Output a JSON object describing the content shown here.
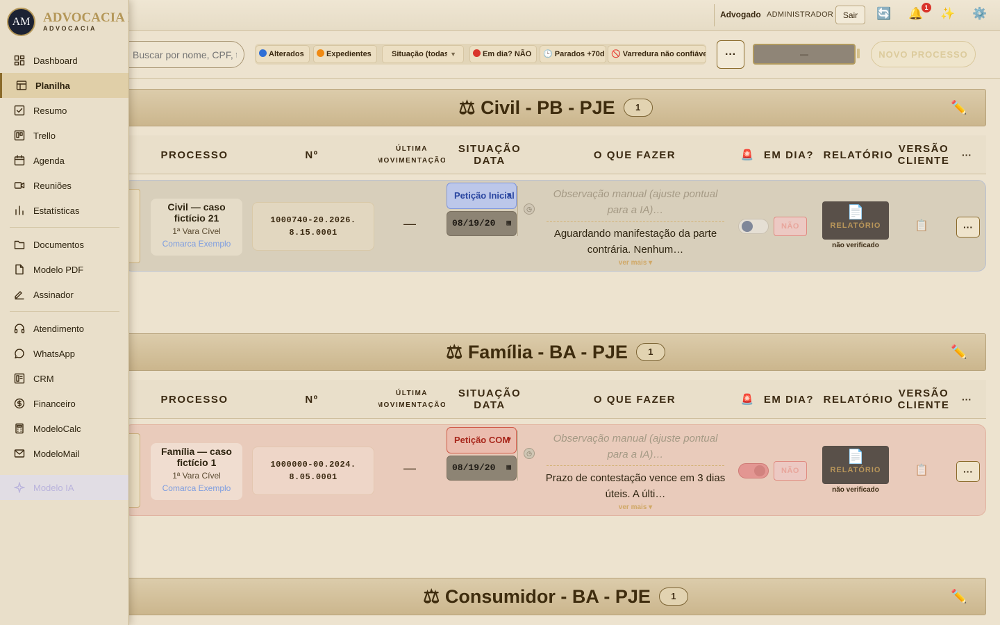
{
  "sidebar": {
    "brand": "ADVOCACIA I",
    "brand_sub": "ADVOCACIA",
    "logo_initials": "AM",
    "items": [
      {
        "label": "Dashboard",
        "icon": "dashboard-icon"
      },
      {
        "label": "Planilha",
        "icon": "table-icon",
        "active": true
      },
      {
        "label": "Resumo",
        "icon": "check-square-icon"
      },
      {
        "label": "Trello",
        "icon": "kanban-icon"
      },
      {
        "label": "Agenda",
        "icon": "calendar-icon"
      },
      {
        "label": "Reuniões",
        "icon": "video-icon"
      },
      {
        "label": "Estatísticas",
        "icon": "bar-chart-icon"
      },
      {
        "label": "Documentos",
        "icon": "folder-icon"
      },
      {
        "label": "Modelo PDF",
        "icon": "file-icon"
      },
      {
        "label": "Assinador",
        "icon": "signature-icon"
      },
      {
        "label": "Atendimento",
        "icon": "headset-icon"
      },
      {
        "label": "WhatsApp",
        "icon": "chat-icon"
      },
      {
        "label": "CRM",
        "icon": "crm-icon"
      },
      {
        "label": "Financeiro",
        "icon": "dollar-icon"
      },
      {
        "label": "ModeloCalc",
        "icon": "calculator-icon"
      },
      {
        "label": "ModeloMail",
        "icon": "mail-icon"
      },
      {
        "label": "Modelo IA",
        "icon": "sparkle-icon",
        "faded": true
      }
    ]
  },
  "topbar": {
    "role": "Advogado",
    "user": "ADMINISTRADOR",
    "logout_label": "Sair",
    "notification_count": "1",
    "icons": [
      "refresh-icon",
      "bell-icon",
      "sparkles-icon",
      "gear-icon"
    ]
  },
  "toolbar": {
    "search_placeholder": "Buscar por nome, CPF, telefone",
    "filters": {
      "alterados": "Alterados",
      "expedientes": "Expedientes",
      "situacao": "Situação (todas)",
      "em_dia": "Em dia? NÃO",
      "parados": "Parados +70d",
      "varredura": "Varredura não confiável"
    },
    "more_label": "···",
    "progress_text": "—",
    "new_process_label": "NOVO PROCESSO"
  },
  "columns": {
    "processo": "PROCESSO",
    "numero": "Nº",
    "ultima_mov": "ÚLTIMA MOVIMENTAÇÃO",
    "situacao_data": "SITUAÇÃO DATA",
    "o_que_fazer": "O QUE FAZER",
    "alert": "🚨",
    "em_dia": "EM DIA?",
    "relatorio": "RELATÓRIO",
    "versao_cliente": "VERSÃO CLIENTE",
    "more": "···"
  },
  "sections": [
    {
      "title": "⚖ Civil - PB - PJE",
      "count": "1",
      "row": {
        "processo_name": "Civil — caso fictício 21",
        "vara": "1ª Vara Cível",
        "comarca": "Comarca Exemplo",
        "numero": "1000740-20.2026.8.15.0001",
        "ultima_mov": "—",
        "situacao": "Petição Inicial",
        "date": "08/19/20",
        "obs_placeholder": "Observação manual (ajuste pontual para a IA)…",
        "o_que_fazer": "Aguardando manifestação da parte contrária. Nenhum…",
        "ver_mais": "ver mais ▾",
        "em_dia": "NÃO",
        "relatorio": "RELATÓRIO",
        "relatorio_status": "não verificado"
      }
    },
    {
      "title": "⚖ Família - BA - PJE",
      "count": "1",
      "row": {
        "processo_name": "Família — caso fictício 1",
        "vara": "1ª Vara Cível",
        "comarca": "Comarca Exemplo",
        "numero": "1000000-00.2024.8.05.0001",
        "ultima_mov": "—",
        "situacao": "Petição COM",
        "date": "08/19/20",
        "obs_placeholder": "Observação manual (ajuste pontual para a IA)…",
        "o_que_fazer": "Prazo de contestação vence em 3 dias úteis. A últi…",
        "ver_mais": "ver mais ▾",
        "em_dia": "NÃO",
        "relatorio": "RELATÓRIO",
        "relatorio_status": "não verificado"
      }
    },
    {
      "title": "⚖ Consumidor - BA - PJE",
      "count": "1"
    }
  ],
  "colors": {
    "accent": "#b49758",
    "status_blue": "#7e95dd",
    "status_red": "#cf5a48",
    "background": "#ede3cf"
  }
}
